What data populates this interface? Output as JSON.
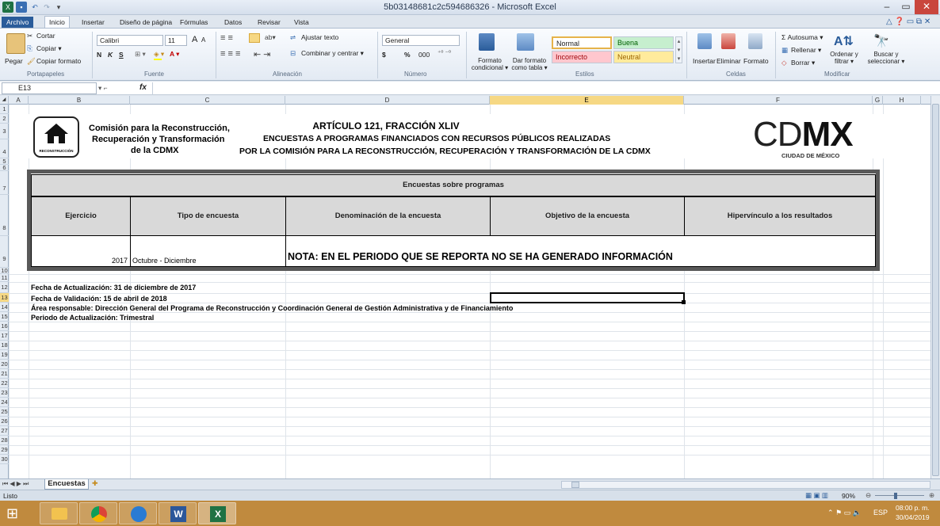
{
  "window": {
    "title": "5b03148681c2c594686326  -  Microsoft Excel",
    "minimize": "–",
    "maximize": "▭",
    "close": "✕"
  },
  "tabs": [
    "Archivo",
    "Inicio",
    "Insertar",
    "Diseño de página",
    "Fórmulas",
    "Datos",
    "Revisar",
    "Vista"
  ],
  "ribbon": {
    "clipboard": {
      "paste": "Pegar",
      "cut": "Cortar",
      "copy": "Copiar ▾",
      "format_painter": "Copiar formato",
      "label": "Portapapeles"
    },
    "font": {
      "name": "Calibri",
      "size": "11",
      "grow": "A",
      "shrink": "A",
      "bold": "N",
      "italic": "K",
      "underline": "S",
      "label": "Fuente"
    },
    "alignment": {
      "wrap": "Ajustar texto",
      "merge": "Combinar y centrar ▾",
      "label": "Alineación"
    },
    "number": {
      "format": "General",
      "currency": "$",
      "percent": "%",
      "thousands": "000",
      "label": "Número"
    },
    "styles": {
      "conditional": "Formato condicional ▾",
      "as_table": "Dar formato como tabla ▾",
      "normal": "Normal",
      "buena": "Buena",
      "incorrecto": "Incorrecto",
      "neutral": "Neutral",
      "label": "Estilos"
    },
    "cells": {
      "insert": "Insertar",
      "delete": "Eliminar",
      "format": "Formato",
      "label": "Celdas"
    },
    "editing": {
      "autosum": "Σ Autosuma ▾",
      "fill": "Rellenar ▾",
      "clear": "Borrar ▾",
      "sort": "Ordenar y filtrar ▾",
      "find": "Buscar y seleccionar ▾",
      "label": "Modificar"
    }
  },
  "formula_bar": {
    "name_box": "E13",
    "fx": "fx",
    "content": ""
  },
  "columns": [
    "A",
    "B",
    "C",
    "D",
    "E",
    "F",
    "G",
    "H"
  ],
  "rows": [
    "1",
    "2",
    "3",
    "4",
    "5",
    "6",
    "7",
    "8",
    "9",
    "10",
    "11",
    "12",
    "13",
    "14",
    "15",
    "16",
    "17",
    "18",
    "19",
    "20",
    "21",
    "22",
    "23",
    "24",
    "25",
    "26",
    "27",
    "28",
    "29",
    "30"
  ],
  "sheet": {
    "org_line1": "Comisión para la Reconstrucción,",
    "org_line2": "Recuperación y Transformación",
    "org_line3": "de la CDMX",
    "logo_caption": "RECONSTRUCCIÓN",
    "article": "ARTÍCULO 121, FRACCIÓN XLIV",
    "subtitle1": "ENCUESTAS A PROGRAMAS FINANCIADOS CON RECURSOS PÚBLICOS REALIZADAS",
    "subtitle2": "POR LA COMISIÓN PARA LA RECONSTRUCCIÓN, RECUPERACIÓN Y TRANSFORMACIÓN DE LA CDMX",
    "cdmx_logo_light": "CD",
    "cdmx_logo_bold": "MX",
    "cdmx_caption": "CIUDAD DE MÉXICO",
    "table_title": "Encuestas sobre programas",
    "headers": [
      "Ejercicio",
      "Tipo de encuesta",
      "Denominación de la encuesta",
      "Objetivo de la encuesta",
      "Hipervínculo a los resultados"
    ],
    "row": {
      "ejercicio": "2017",
      "tipo": "Octubre - Diciembre",
      "nota": "NOTA: EN EL PERIODO QUE SE REPORTA NO SE HA GENERADO INFORMACIÓN"
    },
    "notes": [
      "Fecha de Actualización: 31 de diciembre de 2017",
      "Fecha de Validación: 15 de abril de 2018",
      "Área responsable: Dirección General del Programa de Reconstrucción y Coordinación General de Gestión Administrativa y de Financiamiento",
      "Periodo de Actualización: Trimestral"
    ]
  },
  "sheet_tab": "Encuestas",
  "status": {
    "ready": "Listo",
    "zoom": "90%"
  },
  "taskbar": {
    "lang": "ESP",
    "time": "08:00 p. m.",
    "date": "30/04/2019"
  },
  "colors": {
    "file_tab": "#2a5c9a",
    "selected_header": "#f6d884",
    "table_border": "#595959",
    "header_fill": "#d9d9d9",
    "taskbar": "#c08a3e"
  }
}
